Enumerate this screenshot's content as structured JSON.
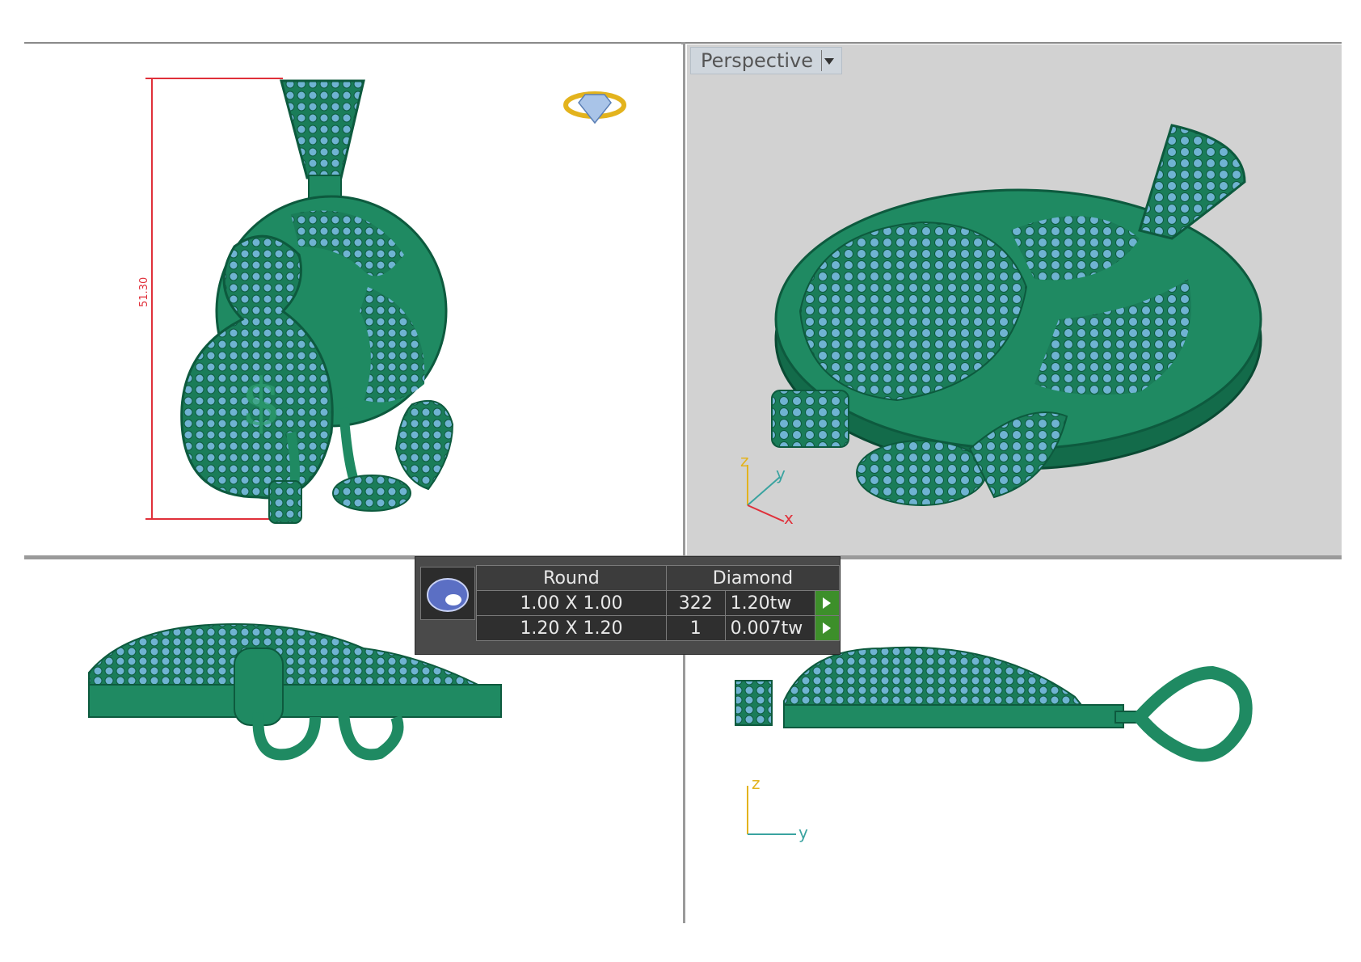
{
  "viewports": {
    "front": {
      "dimension_label": "51.30"
    },
    "perspective": {
      "title": "Perspective",
      "axes": {
        "z": "z",
        "y": "y",
        "x": "x"
      }
    },
    "right": {
      "axes": {
        "z": "z",
        "y": "y"
      }
    }
  },
  "gem_table": {
    "header": {
      "shape": "Round",
      "material": "Diamond"
    },
    "rows": [
      {
        "size": "1.00 X 1.00",
        "count": "322",
        "weight": "1.20tw"
      },
      {
        "size": "1.20 X 1.20",
        "count": "1",
        "weight": "0.007tw"
      }
    ]
  },
  "colors": {
    "model_green": "#1f8a62",
    "model_dark": "#0d5a3e",
    "stone_blue": "#6fb3d2",
    "dimension_red": "#e0303a",
    "perspective_bg": "#d2d2d2"
  }
}
